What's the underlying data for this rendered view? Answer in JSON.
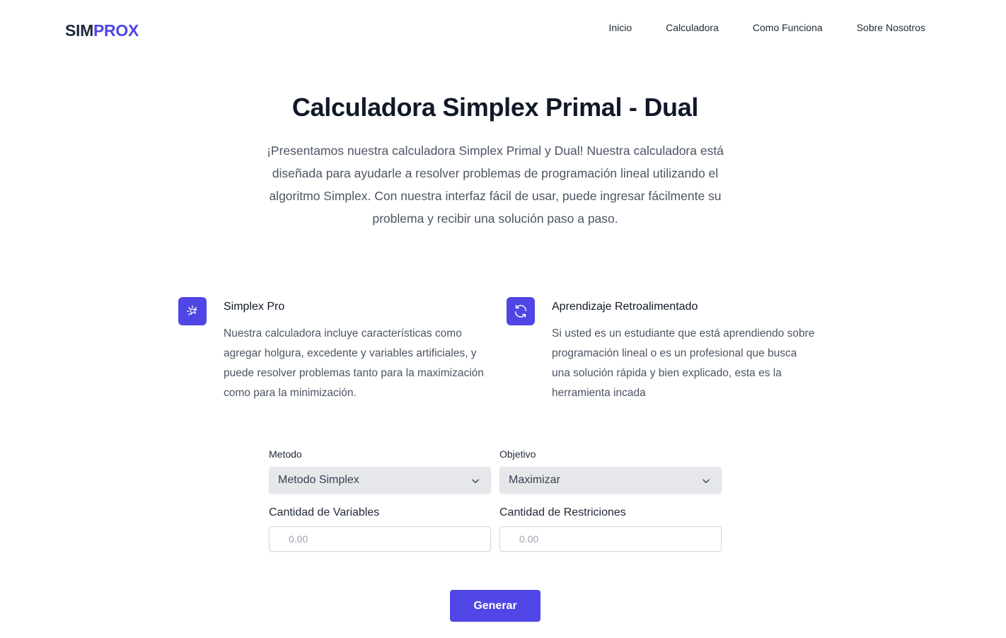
{
  "brand": {
    "logo_part1": "SIM",
    "logo_part2": "PROX",
    "accent_color": "#4f46e5"
  },
  "nav": {
    "items": [
      {
        "label": "Inicio"
      },
      {
        "label": "Calculadora"
      },
      {
        "label": "Como Funciona"
      },
      {
        "label": "Sobre Nosotros"
      }
    ]
  },
  "hero": {
    "title": "Calculadora Simplex Primal - Dual",
    "description": "¡Presentamos nuestra calculadora Simplex Primal y Dual! Nuestra calculadora está diseñada para ayudarle a resolver problemas de programación lineal utilizando el algoritmo Simplex. Con nuestra interfaz fácil de usar, puede ingresar fácilmente su problema y recibir una solución paso a paso."
  },
  "features": [
    {
      "icon": "cursor-click-icon",
      "title": "Simplex Pro",
      "text": "Nuestra calculadora incluye características como agregar holgura, excedente y variables artificiales, y puede resolver problemas tanto para la maximización como para la minimización."
    },
    {
      "icon": "refresh-icon",
      "title": "Aprendizaje Retroalimentado",
      "text": "Si usted es un estudiante que está aprendiendo sobre programación lineal o es un profesional que busca una solución rápida y bien explicado, esta es la herramienta incada"
    }
  ],
  "form": {
    "method": {
      "label": "Metodo",
      "value": "Metodo Simplex"
    },
    "objective": {
      "label": "Objetivo",
      "value": "Maximizar"
    },
    "variables": {
      "label": "Cantidad de Variables",
      "placeholder": "0.00"
    },
    "constraints": {
      "label": "Cantidad de Restriciones",
      "placeholder": "0.00"
    },
    "submit_label": "Generar"
  }
}
